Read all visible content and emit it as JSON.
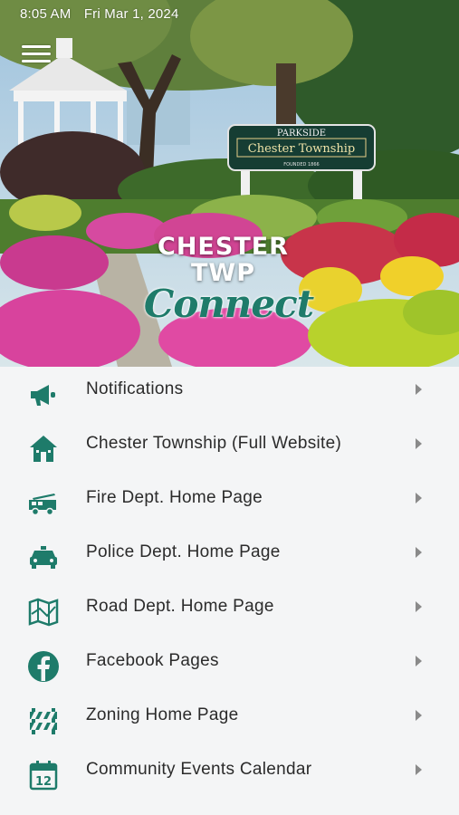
{
  "status_bar": {
    "time": "8:05 AM",
    "date": "Fri Mar 1, 2024"
  },
  "hero": {
    "sign_top": "PARKSIDE",
    "sign_main": "Chester Township",
    "sign_small": "FOUNDED 1866",
    "logo_line1": "CHESTER",
    "logo_line2": "TWP",
    "logo_line3": "Connect"
  },
  "colors": {
    "accent": "#1e7b6a",
    "label": "#2b2b2b",
    "background": "#f4f5f6",
    "chevron": "#8a8a8a"
  },
  "menu": {
    "items": [
      {
        "label": "Notifications",
        "icon": "megaphone-icon"
      },
      {
        "label": "Chester Township (Full Website)",
        "icon": "house-icon"
      },
      {
        "label": "Fire Dept. Home Page",
        "icon": "fire-truck-icon"
      },
      {
        "label": "Police Dept. Home Page",
        "icon": "police-car-icon"
      },
      {
        "label": "Road Dept. Home Page",
        "icon": "map-icon"
      },
      {
        "label": "Facebook Pages",
        "icon": "facebook-icon"
      },
      {
        "label": "Zoning Home Page",
        "icon": "barrier-icon"
      },
      {
        "label": "Community Events Calendar",
        "icon": "calendar-icon"
      }
    ],
    "calendar_day": "12"
  }
}
